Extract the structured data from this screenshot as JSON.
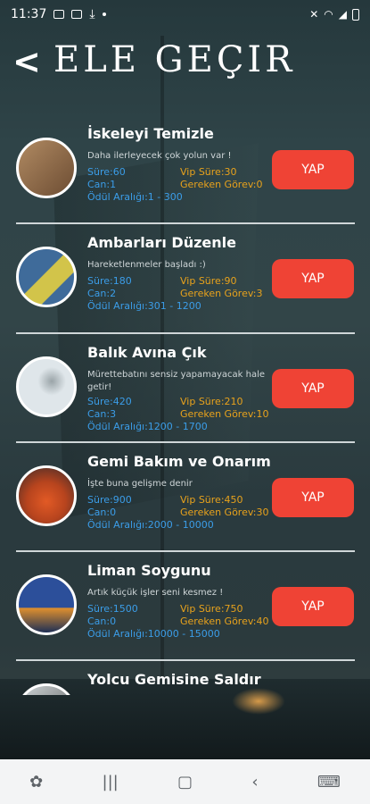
{
  "status_bar": {
    "time": "11:37"
  },
  "header": {
    "back_icon": "chevron-left-icon",
    "title": "ELE GEÇIR"
  },
  "tasks": [
    {
      "title": "İskeleyi Temizle",
      "description": "Daha ilerleyecek çok yolun var !",
      "sure": "Süre:60",
      "can": "Can:1",
      "odul": "Ödül Aralığı:1 - 300",
      "vip_sure": "Vip Süre:30",
      "gereken": "Gereken Görev:0",
      "button": "YAP",
      "image_colors": [
        "#b08a62",
        "#6d4d33"
      ]
    },
    {
      "title": "Ambarları Düzenle",
      "description": "Hareketlenmeler başladı :)",
      "sure": "Süre:180",
      "can": "Can:2",
      "odul": "Ödül Aralığı:301 - 1200",
      "vip_sure": "Vip Süre:90",
      "gereken": "Gereken Görev:3",
      "button": "YAP",
      "image_colors": [
        "#3f6b9a",
        "#d2c44a"
      ]
    },
    {
      "title": "Balık Avına Çık",
      "description": "Mürettebatını sensiz yapamayacak hale getir!",
      "sure": "Süre:420",
      "can": "Can:3",
      "odul": "Ödül Aralığı:1200 - 1700",
      "vip_sure": "Vip Süre:210",
      "gereken": "Gereken Görev:10",
      "button": "YAP",
      "image_colors": [
        "#dfe6ea",
        "#9aa4a8"
      ]
    },
    {
      "title": "Gemi Bakım ve Onarım",
      "description": "İşte buna gelişme denir",
      "sure": "Süre:900",
      "can": "Can:0",
      "odul": "Ödül Aralığı:2000 - 10000",
      "vip_sure": "Vip Süre:450",
      "gereken": "Gereken Görev:30",
      "button": "YAP",
      "image_colors": [
        "#e25a25",
        "#3a2a2a"
      ]
    },
    {
      "title": "Liman Soygunu",
      "description": "Artık küçük işler seni kesmez !",
      "sure": "Süre:1500",
      "can": "Can:0",
      "odul": "Ödül Aralığı:10000 - 15000",
      "vip_sure": "Vip Süre:750",
      "gereken": "Gereken Görev:40",
      "button": "YAP",
      "image_colors": [
        "#2c4f9a",
        "#e0902e"
      ]
    },
    {
      "title": "Yolcu Gemisine Saldır",
      "image_colors": [
        "#cfd6d8",
        "#555555"
      ]
    }
  ]
}
